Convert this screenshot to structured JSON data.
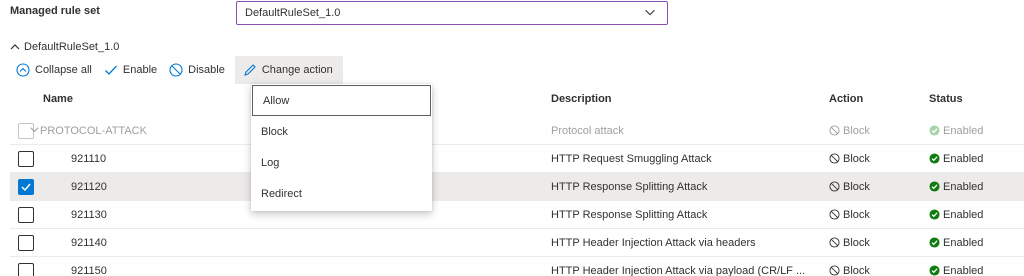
{
  "managed_rule_set": {
    "label": "Managed rule set",
    "selected": "DefaultRuleSet_1.0"
  },
  "section": {
    "title": "DefaultRuleSet_1.0"
  },
  "toolbar": {
    "collapse_all": "Collapse all",
    "enable": "Enable",
    "disable": "Disable",
    "change_action": "Change action"
  },
  "table": {
    "headers": {
      "name": "Name",
      "description": "Description",
      "action": "Action",
      "status": "Status"
    },
    "group": {
      "name": "PROTOCOL-ATTACK",
      "description": "Protocol attack",
      "action": "Block",
      "status": "Enabled"
    },
    "rows": [
      {
        "id": "921110",
        "description": "HTTP Request Smuggling Attack",
        "action": "Block",
        "status": "Enabled",
        "checked": false
      },
      {
        "id": "921120",
        "description": "HTTP Response Splitting Attack",
        "action": "Block",
        "status": "Enabled",
        "checked": true
      },
      {
        "id": "921130",
        "description": "HTTP Response Splitting Attack",
        "action": "Block",
        "status": "Enabled",
        "checked": false
      },
      {
        "id": "921140",
        "description": "HTTP Header Injection Attack via headers",
        "action": "Block",
        "status": "Enabled",
        "checked": false
      },
      {
        "id": "921150",
        "description": "HTTP Header Injection Attack via payload (CR/LF ...",
        "action": "Block",
        "status": "Enabled",
        "checked": false
      }
    ]
  },
  "menu": {
    "items": [
      "Allow",
      "Block",
      "Log",
      "Redirect"
    ]
  },
  "colors": {
    "accent": "#0078d4",
    "enabled_green": "#107c10",
    "select_border": "#8a4fb3"
  }
}
